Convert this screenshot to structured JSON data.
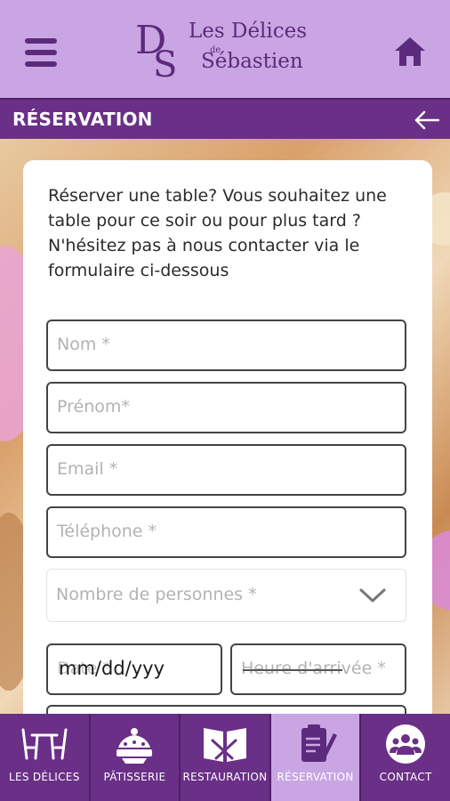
{
  "brand": {
    "monogram": "DS",
    "title": "Les Délices",
    "connector": "de",
    "subtitle": "Sébastien"
  },
  "section": {
    "title": "RÉSERVATION"
  },
  "form": {
    "intro": "Réserver une table? Vous souhaitez une table pour ce soir ou pour plus tard ? N'hésitez pas à nous contacter via le formulaire ci-dessous",
    "nom_placeholder": "Nom *",
    "prenom_placeholder": "Prénom*",
    "email_placeholder": "Email *",
    "telephone_placeholder": "Téléphone *",
    "personnes_placeholder": "Nombre de personnes *",
    "date_placeholder": "Date *",
    "date_value": "mm/dd/yyy",
    "heure_placeholder": "Heure d'arrivée *"
  },
  "nav": [
    {
      "label": "LES DÉLICES",
      "icon": "table-chairs-icon",
      "active": false
    },
    {
      "label": "PÂTISSERIE",
      "icon": "cake-icon",
      "active": false
    },
    {
      "label": "RESTAURATION",
      "icon": "menu-cutlery-icon",
      "active": false
    },
    {
      "label": "RÉSERVATION",
      "icon": "clipboard-pen-icon",
      "active": true
    },
    {
      "label": "CONTACT",
      "icon": "people-icon",
      "active": false
    }
  ],
  "colors": {
    "primary": "#6a2f87",
    "header_bg": "#c9a6e3",
    "active_tab": "#c9a6e3"
  }
}
